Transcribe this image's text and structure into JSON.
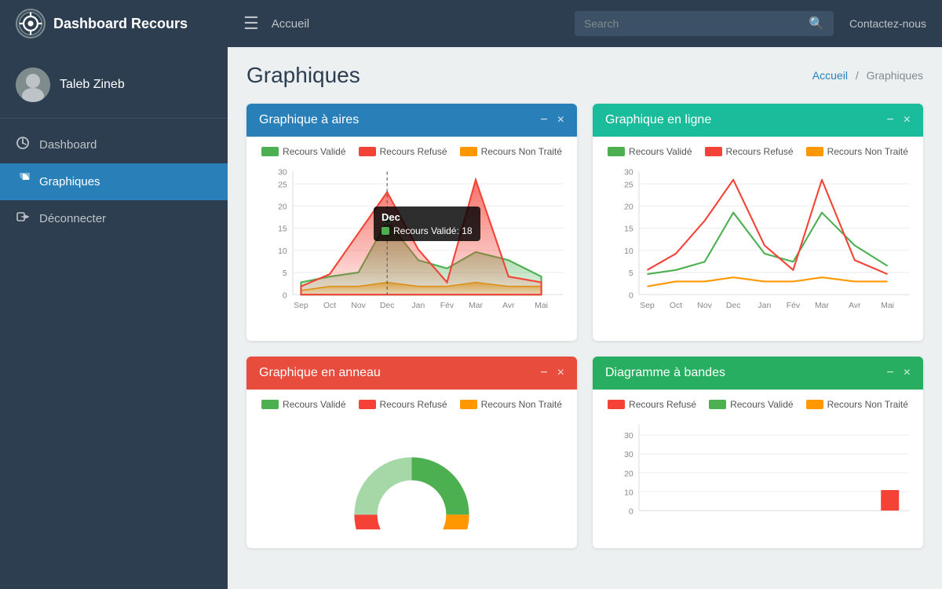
{
  "topnav": {
    "logo_text": "Dashboard Recours",
    "hamburger_icon": "☰",
    "accueil_label": "Accueil",
    "search_placeholder": "Search",
    "search_icon": "🔍",
    "contact_label": "Contactez-nous"
  },
  "sidebar": {
    "username": "Taleb Zineb",
    "items": [
      {
        "label": "Dashboard",
        "icon": "⚙",
        "active": false
      },
      {
        "label": "Graphiques",
        "icon": "◑",
        "active": true
      },
      {
        "label": "Déconnecter",
        "icon": "↪",
        "active": false
      }
    ]
  },
  "main": {
    "page_title": "Graphiques",
    "breadcrumb_home": "Accueil",
    "breadcrumb_sep": "/",
    "breadcrumb_current": "Graphiques"
  },
  "charts": {
    "area": {
      "title": "Graphique à aires",
      "header_class": "chart-header-blue",
      "legend": [
        {
          "label": "Recours Validé",
          "color": "#4caf50"
        },
        {
          "label": "Recours Refusé",
          "color": "#f44336"
        },
        {
          "label": "Recours Non Traité",
          "color": "#ff9800"
        }
      ],
      "x_labels": [
        "Sep",
        "Oct",
        "Nov",
        "Dec",
        "Jan",
        "Fév",
        "Mar",
        "Avr",
        "Mai"
      ],
      "y_labels": [
        "0",
        "5",
        "10",
        "15",
        "20",
        "25",
        "30"
      ],
      "tooltip": {
        "title": "Dec",
        "rows": [
          {
            "label": "Recours Validé: 18",
            "color": "#4caf50"
          }
        ]
      },
      "min_label": "—",
      "action_min": "−",
      "action_close": "×"
    },
    "line": {
      "title": "Graphique en ligne",
      "header_class": "chart-header-teal",
      "legend": [
        {
          "label": "Recours Validé",
          "color": "#4caf50"
        },
        {
          "label": "Recours Refusé",
          "color": "#f44336"
        },
        {
          "label": "Recours Non Traité",
          "color": "#ff9800"
        }
      ],
      "x_labels": [
        "Sep",
        "Oct",
        "Nov",
        "Dec",
        "Jan",
        "Fév",
        "Mar",
        "Avr",
        "Mai"
      ],
      "y_labels": [
        "0",
        "5",
        "10",
        "15",
        "20",
        "25",
        "30"
      ],
      "action_min": "−",
      "action_close": "×"
    },
    "donut": {
      "title": "Graphique en anneau",
      "header_class": "chart-header-red",
      "legend": [
        {
          "label": "Recours Validé",
          "color": "#4caf50"
        },
        {
          "label": "Recours Refusé",
          "color": "#f44336"
        },
        {
          "label": "Recours Non Traité",
          "color": "#ff9800"
        }
      ],
      "action_min": "−",
      "action_close": "×"
    },
    "bar": {
      "title": "Diagramme à bandes",
      "header_class": "chart-header-green",
      "legend": [
        {
          "label": "Recours Refusé",
          "color": "#f44336"
        },
        {
          "label": "Recours Validé",
          "color": "#4caf50"
        },
        {
          "label": "Recours Non Traité",
          "color": "#ff9800"
        }
      ],
      "y_label_30": "30",
      "action_min": "−",
      "action_close": "×"
    }
  }
}
